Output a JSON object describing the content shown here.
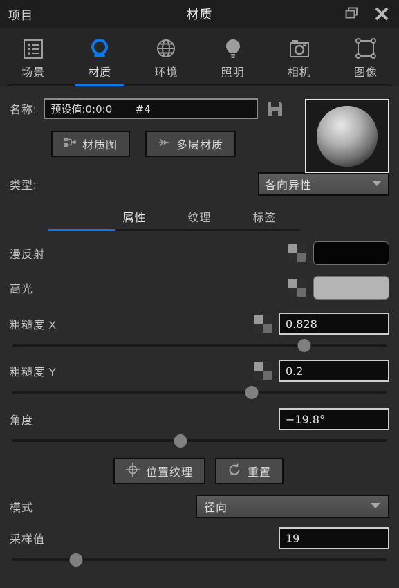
{
  "titlebar": {
    "project_label": "项目",
    "title": "材质",
    "restore_icon": "restore-window-icon",
    "close_icon": "close-icon"
  },
  "tabs": [
    {
      "label": "场景",
      "icon": "list-icon",
      "active": false
    },
    {
      "label": "材质",
      "icon": "sphere-icon",
      "active": true
    },
    {
      "label": "环境",
      "icon": "globe-icon",
      "active": false
    },
    {
      "label": "照明",
      "icon": "bulb-icon",
      "active": false
    },
    {
      "label": "相机",
      "icon": "camera-icon",
      "active": false
    },
    {
      "label": "图像",
      "icon": "frame-icon",
      "active": false
    }
  ],
  "name_row": {
    "label": "名称:",
    "value": "预设值:0:0:0       #4",
    "placeholder": "预设值:0:0:0       #4",
    "save_icon": "floppy-save-icon"
  },
  "action_buttons": [
    {
      "label": "材质图",
      "icon": "node-graph-icon"
    },
    {
      "label": "多层材质",
      "icon": "layers-branch-icon"
    }
  ],
  "type_row": {
    "label": "类型:",
    "value": "各向异性",
    "options": [
      "各向异性"
    ]
  },
  "subtabs": [
    {
      "label": "属性",
      "active": true
    },
    {
      "label": "纹理",
      "active": false
    },
    {
      "label": "标签",
      "active": false
    }
  ],
  "properties": {
    "diffuse": {
      "label": "漫反射",
      "color": "#050505",
      "texture_icon": "checker-icon"
    },
    "specular": {
      "label": "高光",
      "color": "#b4b4b4",
      "texture_icon": "checker-icon"
    },
    "roughness_x": {
      "label": "粗糙度 X",
      "value": "0.828",
      "slider_percent": 78,
      "texture_icon": "checker-icon"
    },
    "roughness_y": {
      "label": "粗糙度 Y",
      "value": "0.2",
      "slider_percent": 64,
      "texture_icon": "checker-icon"
    },
    "angle": {
      "label": "角度",
      "value": "−19.8°",
      "slider_percent": 45
    }
  },
  "texture_buttons": [
    {
      "label": "位置纹理",
      "icon": "crosshair-icon"
    },
    {
      "label": "重置",
      "icon": "refresh-icon"
    }
  ],
  "mode_row": {
    "label": "模式",
    "value": "径向",
    "options": [
      "径向"
    ]
  },
  "sample_row": {
    "label": "采样值",
    "value": "19",
    "slider_percent": 17
  },
  "colors": {
    "accent": "#0b76ef",
    "panel_bg": "#2b2b2b",
    "titlebar_bg": "#1e1e1e",
    "tabstrip_bg": "#262626"
  }
}
